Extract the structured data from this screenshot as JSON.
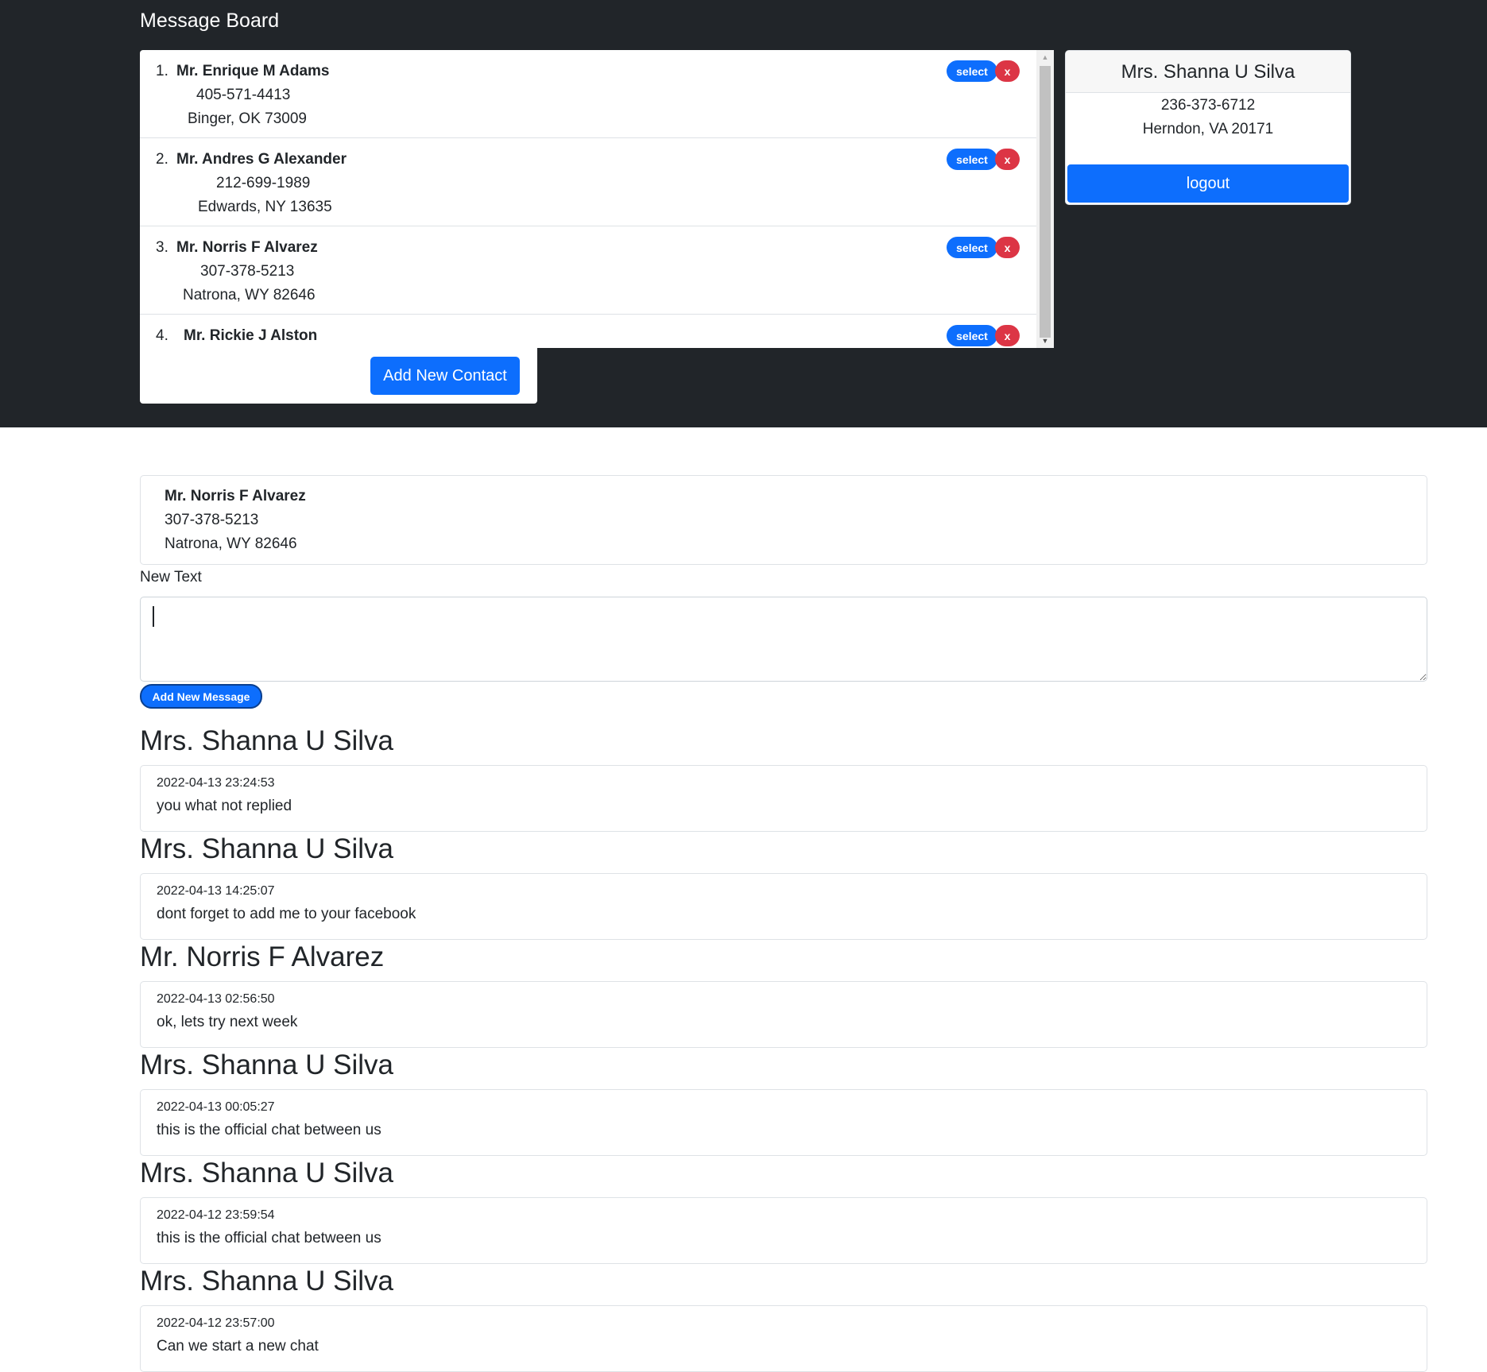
{
  "header": {
    "title": "Message Board"
  },
  "contacts": [
    {
      "num": "1.",
      "name": "Mr. Enrique M Adams",
      "phone": "405-571-4413",
      "address": "Binger, OK 73009"
    },
    {
      "num": "2.",
      "name": "Mr. Andres G Alexander",
      "phone": "212-699-1989",
      "address": "Edwards, NY 13635"
    },
    {
      "num": "3.",
      "name": "Mr. Norris F Alvarez",
      "phone": "307-378-5213",
      "address": "Natrona, WY 82646"
    },
    {
      "num": "4.",
      "name": "Mr. Rickie J Alston",
      "phone": "",
      "address": ""
    }
  ],
  "contact_actions": {
    "select_label": "select",
    "delete_label": "x"
  },
  "add_contact_label": "Add New Contact",
  "user": {
    "name": "Mrs. Shanna U Silva",
    "phone": "236-373-6712",
    "address": "Herndon, VA 20171",
    "logout_label": "logout"
  },
  "selected_contact": {
    "name": "Mr. Norris F Alvarez",
    "phone": "307-378-5213",
    "address": "Natrona, WY 82646"
  },
  "composer": {
    "label": "New Text",
    "value": "",
    "submit_label": "Add New Message"
  },
  "messages": [
    {
      "author": "Mrs. Shanna U Silva",
      "timestamp": "2022-04-13 23:24:53",
      "text": "you what not replied"
    },
    {
      "author": "Mrs. Shanna U Silva",
      "timestamp": "2022-04-13 14:25:07",
      "text": "dont forget to add me to your facebook"
    },
    {
      "author": "Mr. Norris F Alvarez",
      "timestamp": "2022-04-13 02:56:50",
      "text": "ok, lets try next week"
    },
    {
      "author": "Mrs. Shanna U Silva",
      "timestamp": "2022-04-13 00:05:27",
      "text": "this is the official chat between us"
    },
    {
      "author": "Mrs. Shanna U Silva",
      "timestamp": "2022-04-12 23:59:54",
      "text": "this is the official chat between us"
    },
    {
      "author": "Mrs. Shanna U Silva",
      "timestamp": "2022-04-12 23:57:00",
      "text": "Can we start a new chat"
    }
  ],
  "colors": {
    "header_bg": "#212529",
    "primary": "#0d6efd",
    "danger": "#dc3545"
  }
}
